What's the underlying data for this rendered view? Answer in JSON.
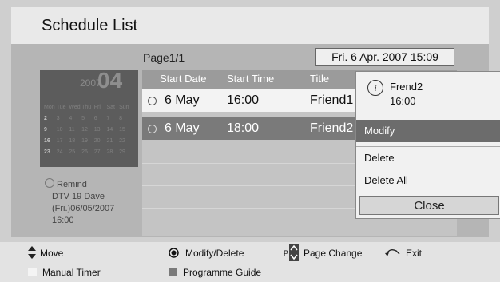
{
  "title": "Schedule List",
  "page": "Page1/1",
  "datetime": "Fri. 6 Apr. 2007 15:09",
  "calendar": {
    "year": "2007",
    "month": "04",
    "weekdays": [
      "Mon",
      "Tue",
      "Wed",
      "Thu",
      "Fri",
      "Sat",
      "Sun"
    ],
    "rows": [
      [
        "2",
        "3",
        "4",
        "5",
        "6",
        "7",
        "8"
      ],
      [
        "9",
        "10",
        "11",
        "12",
        "13",
        "14",
        "15"
      ],
      [
        "16",
        "17",
        "18",
        "19",
        "20",
        "21",
        "22"
      ],
      [
        "23",
        "24",
        "25",
        "26",
        "27",
        "28",
        "29"
      ]
    ]
  },
  "remind": {
    "label": "Remind",
    "channel": "DTV 19 Dave",
    "date": "(Fri.)06/05/2007",
    "time": "16:00"
  },
  "columns": {
    "start_date": "Start Date",
    "start_time": "Start Time",
    "title": "Title"
  },
  "rows": [
    {
      "date": "6 May",
      "time": "16:00",
      "title": "Friend1"
    },
    {
      "date": "6 May",
      "time": "18:00",
      "title": "Friend2"
    }
  ],
  "popup": {
    "info_glyph": "i",
    "program": "Frend2",
    "time": "16:00",
    "options": [
      "Modify",
      "Delete",
      "Delete All"
    ],
    "close": "Close"
  },
  "footer": {
    "move": "Move",
    "modify_delete": "Modify/Delete",
    "page_prefix": "P",
    "page_change": "Page Change",
    "exit": "Exit",
    "manual_timer": "Manual Timer",
    "programme_guide": "Programme Guide"
  },
  "colors": {
    "yellow_key": "#f2f2f2",
    "blue_key": "#7a7a7a"
  }
}
